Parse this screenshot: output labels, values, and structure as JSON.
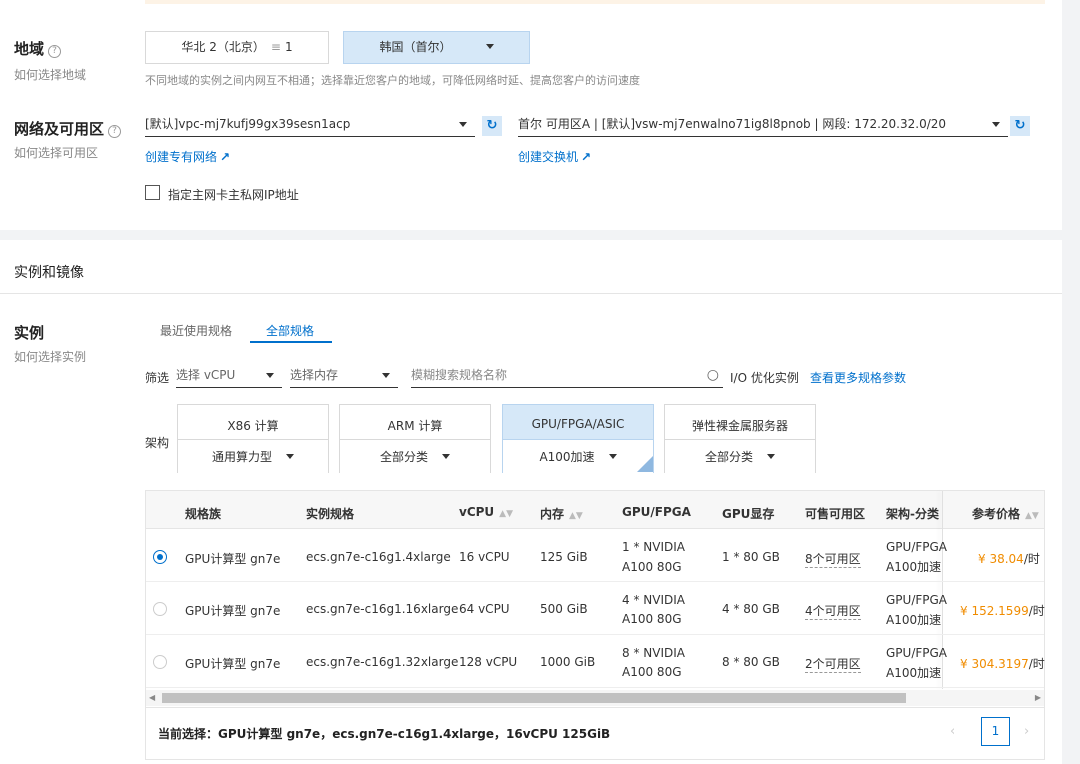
{
  "region": {
    "label": "地域",
    "help": "?",
    "sub": "如何选择地域",
    "options": [
      {
        "label": "华北 2（北京）",
        "extra": "1"
      },
      {
        "label": "韩国（首尔）"
      }
    ],
    "hint": "不同地域的实例之间内网互不相通；选择靠近您客户的地域，可降低网络时延、提高您客户的访问速度"
  },
  "network": {
    "label": "网络及可用区",
    "help": "?",
    "sub": "如何选择可用区",
    "vpc_value": "[默认]vpc-mj7kufj99gx39sesn1acp",
    "vswitch_value": "首尔 可用区A | [默认]vsw-mj7enwalno71ig8l8pnob | 网段: 172.20.32.0/20",
    "create_vpc": "创建专有网络",
    "create_vswitch": "创建交换机",
    "private_ip_checkbox": "指定主网卡主私网IP地址",
    "refresh_icon": "refresh-icon",
    "external_icon": "external-link-icon"
  },
  "section": {
    "title": "实例和镜像"
  },
  "instance": {
    "label": "实例",
    "sub": "如何选择实例",
    "tabs": [
      "最近使用规格",
      "全部规格"
    ],
    "active_tab": 1,
    "filter_label": "筛选",
    "vcpu_placeholder": "选择 vCPU",
    "mem_placeholder": "选择内存",
    "search_placeholder": "模糊搜索规格名称",
    "io_optimized": "I/O 优化实例",
    "more_params": "查看更多规格参数",
    "arch_label": "架构",
    "arch": [
      {
        "title": "X86 计算",
        "sub": "通用算力型",
        "selected": false
      },
      {
        "title": "ARM 计算",
        "sub": "全部分类",
        "selected": false
      },
      {
        "title": "GPU/FPGA/ASIC",
        "sub": "A100加速",
        "selected": true
      },
      {
        "title": "弹性裸金属服务器",
        "sub": "全部分类",
        "selected": false
      }
    ]
  },
  "table": {
    "headers": [
      "规格族",
      "实例规格",
      "vCPU",
      "内存",
      "GPU/FPGA",
      "GPU显存",
      "可售可用区",
      "架构-分类",
      "参考价格"
    ],
    "rows": [
      {
        "selected": true,
        "family": "GPU计算型 gn7e",
        "spec": "ecs.gn7e-c16g1.4xlarge",
        "vcpu": "16 vCPU",
        "mem": "125 GiB",
        "gpu1": "1 * NVIDIA",
        "gpu2": "A100 80G",
        "gpumem": "1 * 80 GB",
        "zones": "8个可用区",
        "arch1": "GPU/FPGA",
        "arch2": "A100加速",
        "price": "¥ 38.04",
        "unit": "/时"
      },
      {
        "selected": false,
        "family": "GPU计算型 gn7e",
        "spec": "ecs.gn7e-c16g1.16xlarge",
        "vcpu": "64 vCPU",
        "mem": "500 GiB",
        "gpu1": "4 * NVIDIA",
        "gpu2": "A100 80G",
        "gpumem": "4 * 80 GB",
        "zones": "4个可用区",
        "arch1": "GPU/FPGA",
        "arch2": "A100加速",
        "price": "¥ 152.1599",
        "unit": "/时"
      },
      {
        "selected": false,
        "family": "GPU计算型 gn7e",
        "spec": "ecs.gn7e-c16g1.32xlarge",
        "vcpu": "128 vCPU",
        "mem": "1000 GiB",
        "gpu1": "8 * NVIDIA",
        "gpu2": "A100 80G",
        "gpumem": "8 * 80 GB",
        "zones": "2个可用区",
        "arch1": "GPU/FPGA",
        "arch2": "A100加速",
        "price": "¥ 304.3197",
        "unit": "/时"
      }
    ],
    "current_selection": "当前选择：GPU计算型 gn7e，ecs.gn7e-c16g1.4xlarge，16vCPU 125GiB",
    "page": "1"
  },
  "colors": {
    "accent": "#0070cc",
    "selected_bg": "#d6e8f8",
    "price": "#f08c00"
  }
}
